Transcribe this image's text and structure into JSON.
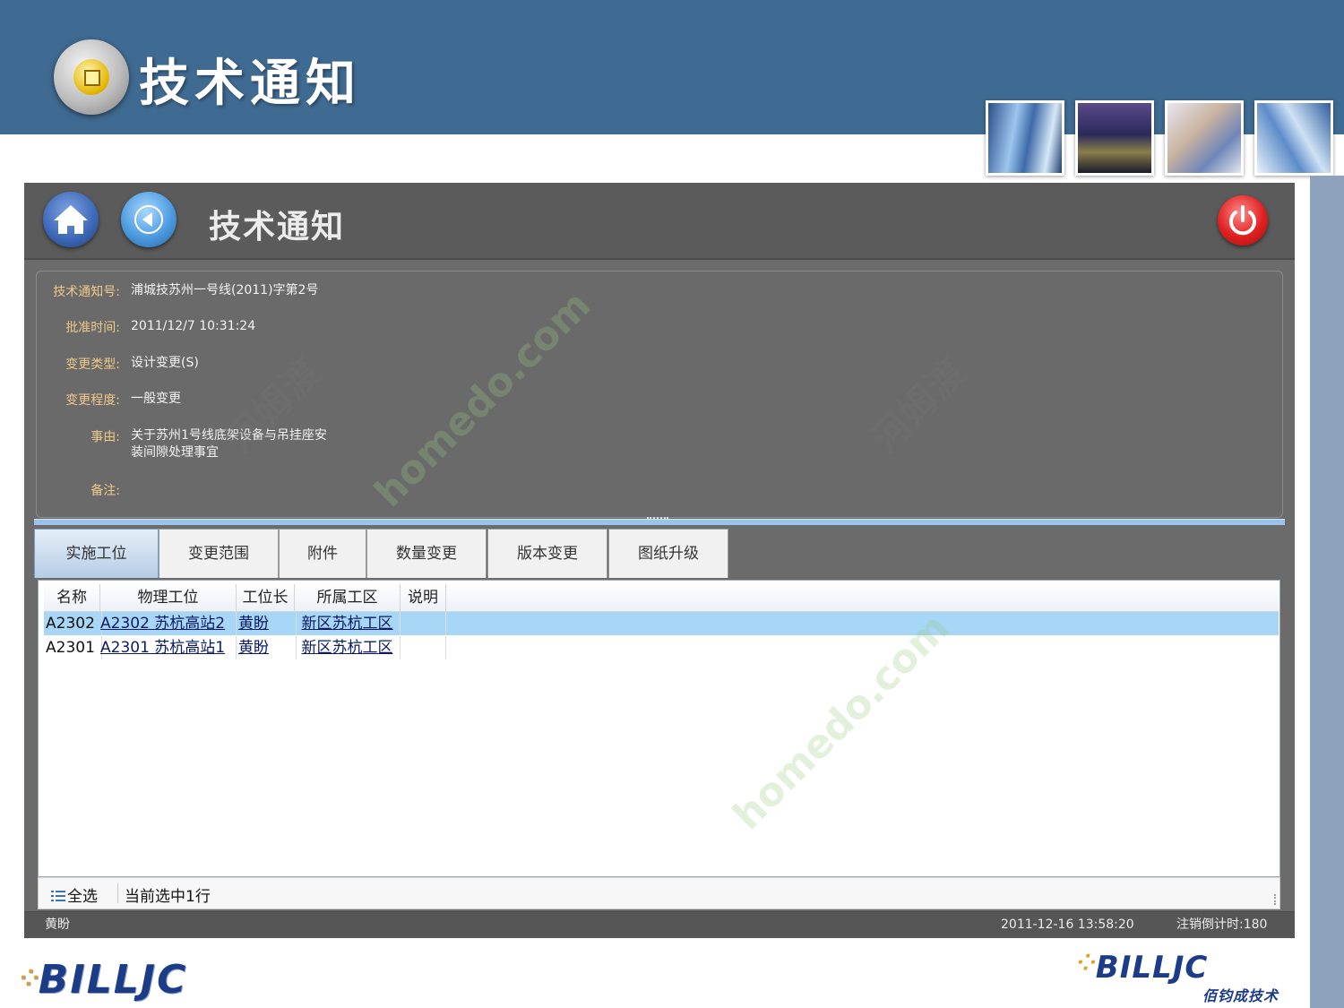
{
  "slide": {
    "title": "技术通知",
    "thumbnails": [
      "city-building-photo",
      "night-skyline-photo",
      "phone-call-photo",
      "glass-tower-photo"
    ]
  },
  "app": {
    "title": "技术通知",
    "buttons": {
      "home": "home-icon",
      "back": "back-arrow-icon",
      "power": "power-icon"
    },
    "colors": {
      "window": "#6b6b6b",
      "header": "#5b5b5b",
      "label": "#efc989",
      "selected_row": "#a7d6f6",
      "link": "#0c1a66"
    }
  },
  "info": {
    "notice_no_label": "技术通知号:",
    "notice_no": "浦城技苏州一号线(2011)字第2号",
    "approved_time_label": "批准时间:",
    "approved_time": "2011/12/7 10:31:24",
    "change_type_label": "变更类型:",
    "change_type": "设计变更(S)",
    "change_degree_label": "变更程度:",
    "change_degree": "一般变更",
    "reason_label": "事由:",
    "reason_line1": "关于苏州1号线底架设备与吊挂座安",
    "reason_line2": "装间隙处理事宜",
    "remark_label": "备注:",
    "remark": ""
  },
  "tabs": [
    {
      "label": "实施工位",
      "active": true
    },
    {
      "label": "变更范围",
      "active": false
    },
    {
      "label": "附件",
      "active": false
    },
    {
      "label": "数量变更",
      "active": false
    },
    {
      "label": "版本变更",
      "active": false
    },
    {
      "label": "图纸升级",
      "active": false
    }
  ],
  "table": {
    "columns": [
      "名称",
      "物理工位",
      "工位长",
      "所属工区",
      "说明"
    ],
    "rows": [
      {
        "name": "A2302",
        "station": "A2302 苏杭高站2",
        "leader": "黄盼",
        "area": "新区苏杭工区",
        "note": "",
        "selected": true
      },
      {
        "name": "A2301",
        "station": "A2301 苏杭高站1",
        "leader": "黄盼",
        "area": "新区苏杭工区",
        "note": "",
        "selected": false
      }
    ]
  },
  "footer": {
    "select_all": "全选",
    "status": "当前选中1行"
  },
  "statusbar": {
    "user": "黄盼",
    "time": "2011-12-16 13:58:20",
    "logout_timer": "注销倒计时:180"
  },
  "branding": {
    "logo_left": "BILLJC",
    "logo_right": "BILLJC",
    "logo_right_sub": "佰钧成技术"
  },
  "watermark": {
    "text1": "homedo.com",
    "text2": "河姆渡"
  }
}
